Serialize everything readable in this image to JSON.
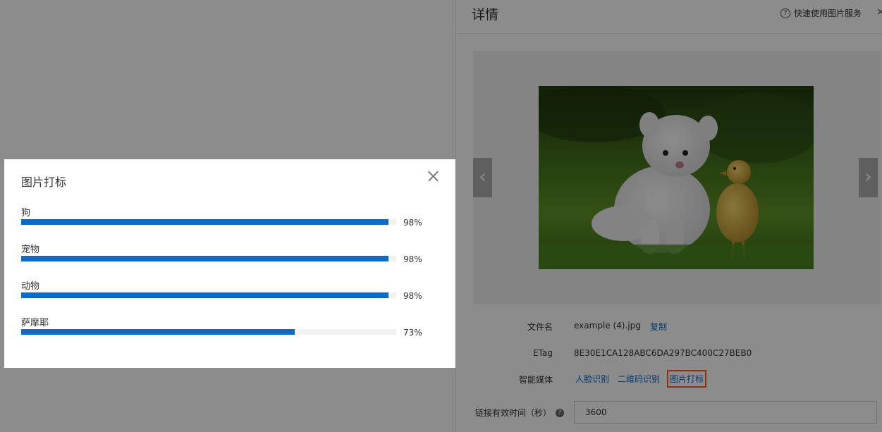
{
  "detail": {
    "title": "详情",
    "help_link": "快速使用图片服务",
    "help_icon": "?",
    "close_icon": "×",
    "prev_arrow": "‹",
    "next_arrow": "›",
    "filename_label": "文件名",
    "filename_value": "example (4).jpg",
    "copy_label": "复制",
    "etag_label": "ETag",
    "etag_value": "8E30E1CA128ABC6DA297BC400C27BEB0",
    "media_label": "智能媒体",
    "media_links": [
      "人脸识别",
      "二维码识别",
      "图片打标"
    ],
    "expire_label": "链接有效时间（秒）",
    "expire_help": "?",
    "expire_value": "3600"
  },
  "modal": {
    "title": "图片打标",
    "tags": [
      {
        "name": "狗",
        "percent_text": "98%",
        "value": 0.98
      },
      {
        "name": "宠物",
        "percent_text": "98%",
        "value": 0.98
      },
      {
        "name": "动物",
        "percent_text": "98%",
        "value": 0.98
      },
      {
        "name": "萨摩耶",
        "percent_text": "73%",
        "value": 0.73
      }
    ]
  },
  "colors": {
    "accent": "#0a6bc9",
    "highlight": "#ff5a1f"
  }
}
